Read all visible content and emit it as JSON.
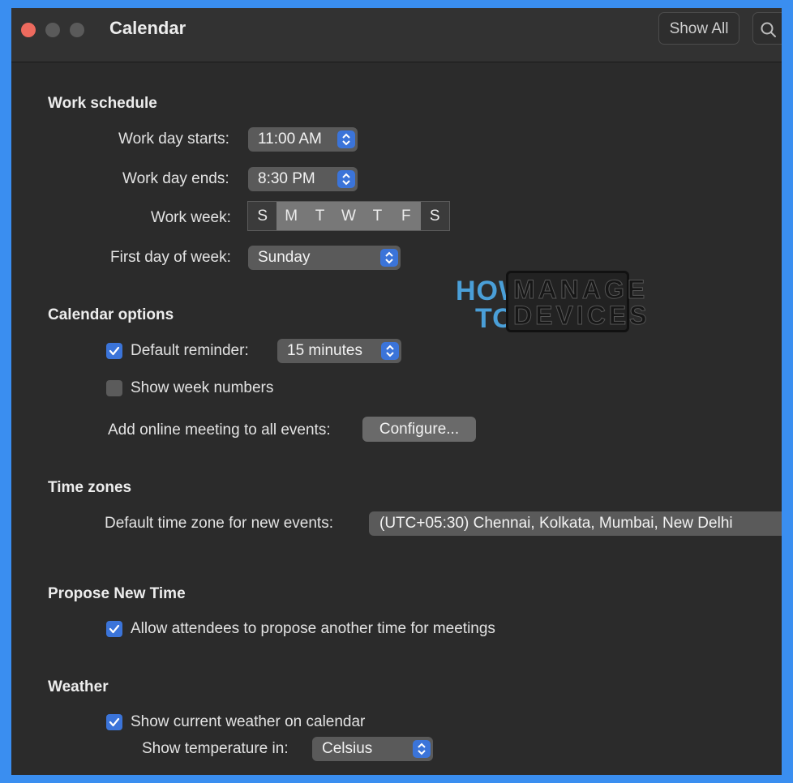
{
  "window": {
    "title": "Calendar",
    "show_all": "Show All",
    "search_icon": "search-icon"
  },
  "work_schedule": {
    "heading": "Work schedule",
    "start_label": "Work day starts:",
    "start_value": "11:00 AM",
    "end_label": "Work day ends:",
    "end_value": "8:30 PM",
    "week_label": "Work week:",
    "days": [
      {
        "letter": "S",
        "selected": false
      },
      {
        "letter": "M",
        "selected": true
      },
      {
        "letter": "T",
        "selected": true
      },
      {
        "letter": "W",
        "selected": true
      },
      {
        "letter": "T",
        "selected": true
      },
      {
        "letter": "F",
        "selected": true
      },
      {
        "letter": "S",
        "selected": false
      }
    ],
    "first_day_label": "First day of week:",
    "first_day_value": "Sunday"
  },
  "watermark": {
    "how": "HOW",
    "to": "TO",
    "manage": "MANAGE",
    "devices": "DEVICES"
  },
  "calendar_options": {
    "heading": "Calendar options",
    "default_reminder_label": "Default reminder:",
    "default_reminder_checked": true,
    "default_reminder_value": "15 minutes",
    "week_numbers_label": "Show week numbers",
    "week_numbers_checked": false,
    "online_meeting_label": "Add online meeting to all events:",
    "configure_button": "Configure..."
  },
  "time_zones": {
    "heading": "Time zones",
    "default_label": "Default time zone for new events:",
    "default_value": "(UTC+05:30) Chennai, Kolkata, Mumbai, New Delhi"
  },
  "propose_new_time": {
    "heading": "Propose New Time",
    "allow_label": "Allow attendees to propose another time for meetings",
    "allow_checked": true
  },
  "weather": {
    "heading": "Weather",
    "show_label": "Show current weather on calendar",
    "show_checked": true,
    "temp_label": "Show temperature in:",
    "temp_value": "Celsius"
  },
  "colors": {
    "accent": "#3b74d9",
    "window_bg": "#2b2b2b",
    "frame": "#3a8ef0",
    "close": "#ed6a5e"
  }
}
